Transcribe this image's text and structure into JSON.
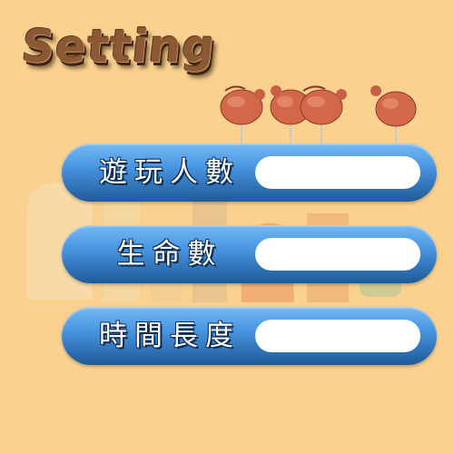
{
  "title": "Setting",
  "settings": [
    {
      "label": "遊玩人數",
      "value": ""
    },
    {
      "label": "生命數",
      "value": ""
    },
    {
      "label": "時間長度",
      "value": ""
    }
  ],
  "colors": {
    "background": "#fad18f",
    "panel": "#3d86d0",
    "title": "#8b5a35"
  }
}
